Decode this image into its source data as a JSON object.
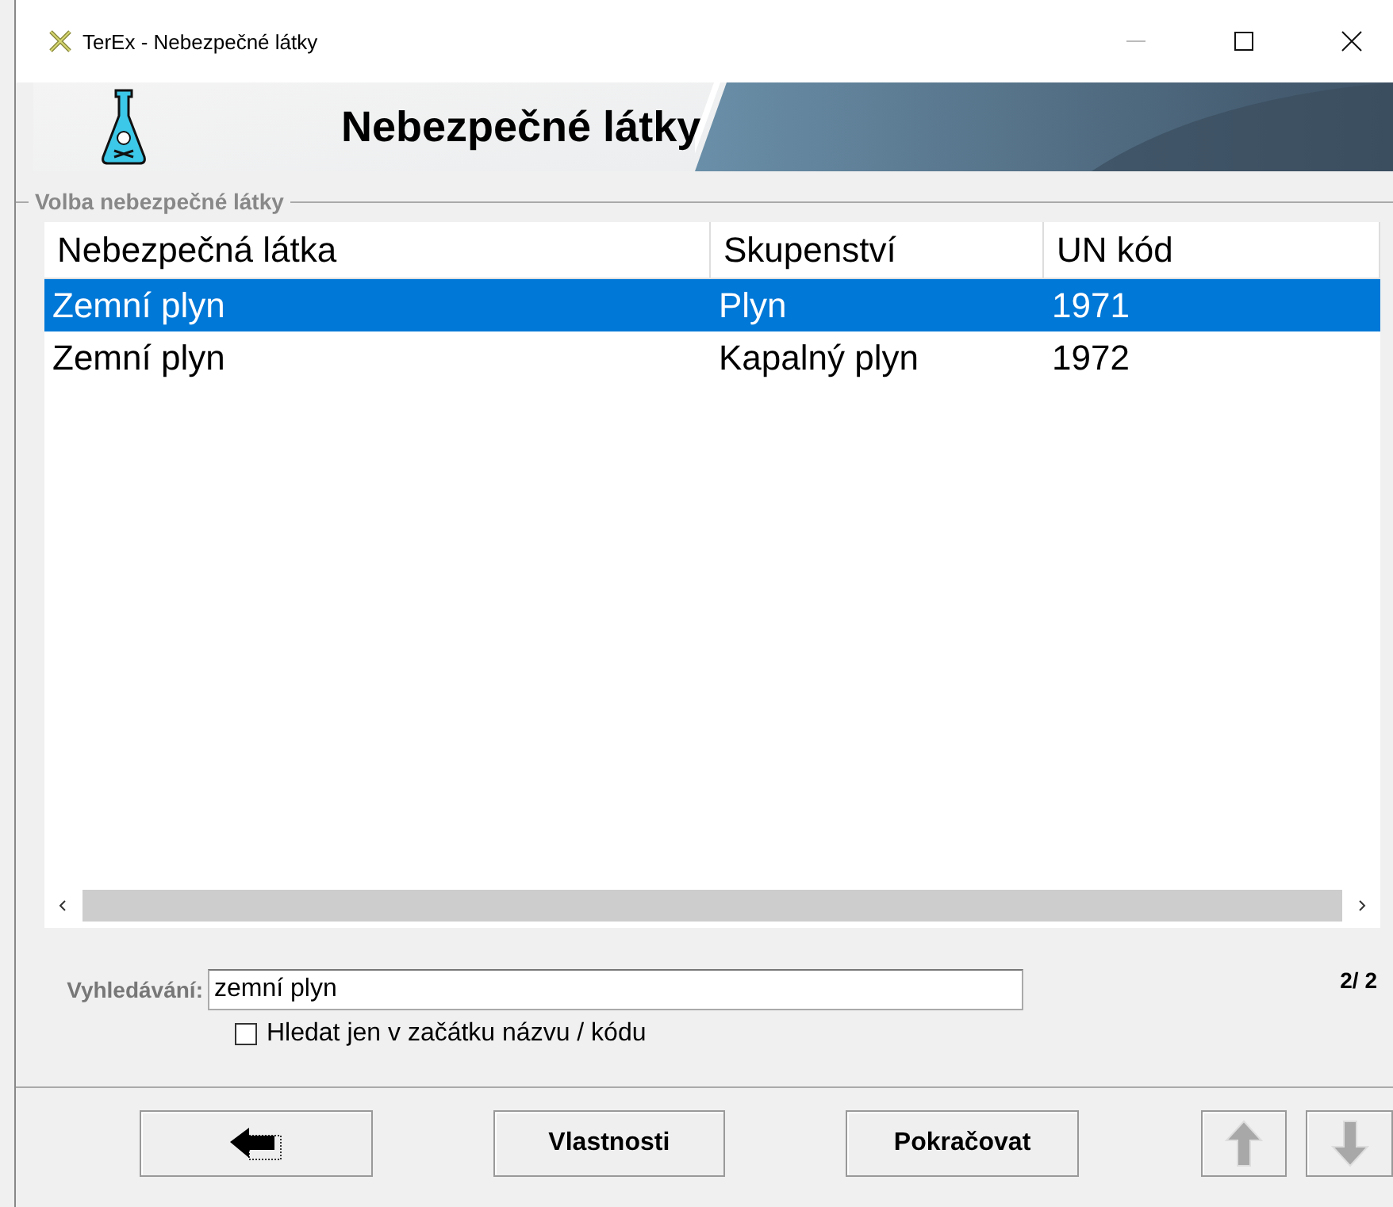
{
  "window": {
    "title": "TerEx  - Nebezpečné látky"
  },
  "banner": {
    "title": "Nebezpečné látky"
  },
  "group": {
    "title": "Volba nebezpečné látky"
  },
  "table": {
    "columns": [
      "Nebezpečná látka",
      "Skupenství",
      "UN kód"
    ],
    "rows": [
      {
        "cells": [
          "Zemní plyn",
          "Plyn",
          "1971"
        ],
        "selected": true
      },
      {
        "cells": [
          "Zemní plyn",
          "Kapalný plyn",
          "1972"
        ],
        "selected": false
      }
    ]
  },
  "search": {
    "label": "Vyhledávání:",
    "value": "zemní plyn",
    "count": "2/ 2"
  },
  "option": {
    "label": "Hledat jen v začátku názvu / kódu",
    "checked": false
  },
  "buttons": [
    {
      "kind": "back",
      "disabled": false
    },
    {
      "kind": "text",
      "label": "Vlastnosti",
      "disabled": false
    },
    {
      "kind": "text",
      "label": "Pokračovat",
      "disabled": false
    },
    {
      "kind": "up",
      "disabled": true
    },
    {
      "kind": "down",
      "disabled": true
    }
  ]
}
